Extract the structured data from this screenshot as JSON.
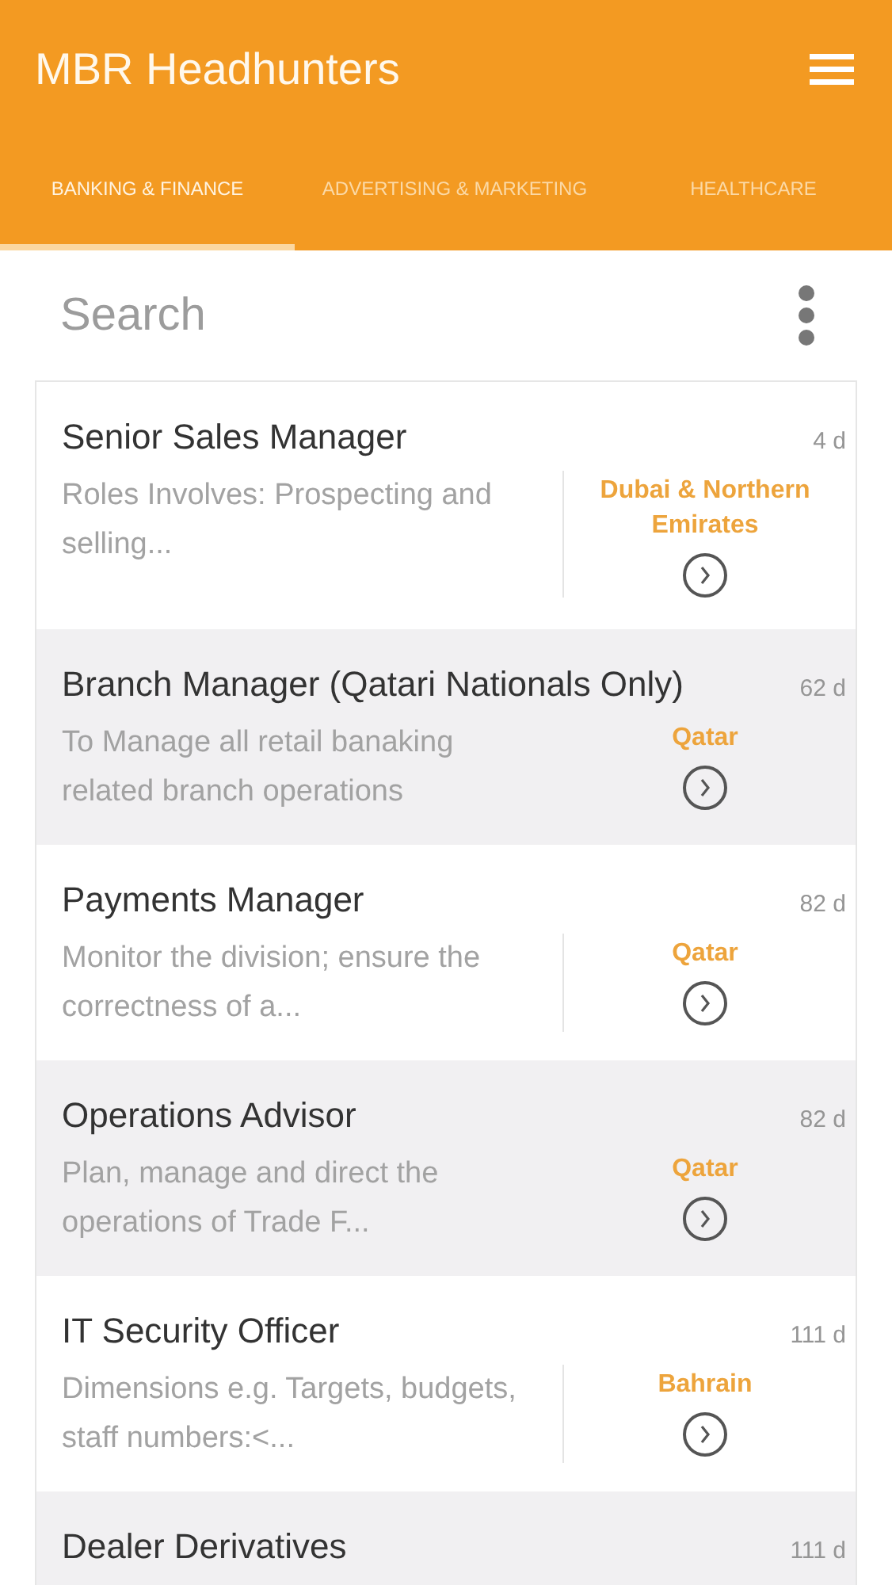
{
  "app_bar": {
    "title": "MBR Headhunters"
  },
  "tabs": [
    {
      "label": "BANKING & FINANCE",
      "selected": true
    },
    {
      "label": "ADVERTISING & MARKETING",
      "selected": false
    },
    {
      "label": "HEALTHCARE",
      "selected": false
    }
  ],
  "search": {
    "placeholder": "Search"
  },
  "jobs": [
    {
      "title": "Senior Sales Manager",
      "age": "4 d",
      "description": "Roles Involves: Prospecting and selling...",
      "location": "Dubai & Northern Emirates"
    },
    {
      "title": "Branch Manager (Qatari Nationals Only)",
      "age": "62 d",
      "description": "To Manage all retail banaking related branch operations",
      "location": "Qatar"
    },
    {
      "title": "Payments Manager",
      "age": "82 d",
      "description": "Monitor the division; ensure the correctness of a...",
      "location": "Qatar"
    },
    {
      "title": "Operations Advisor",
      "age": "82 d",
      "description": "Plan, manage and direct the operations of Trade F...",
      "location": "Qatar"
    },
    {
      "title": "IT Security Officer",
      "age": "111 d",
      "description": "Dimensions e.g. Targets, budgets, staff numbers:<...",
      "location": "Bahrain"
    },
    {
      "title": "Dealer Derivatives",
      "age": "111 d"
    }
  ]
}
